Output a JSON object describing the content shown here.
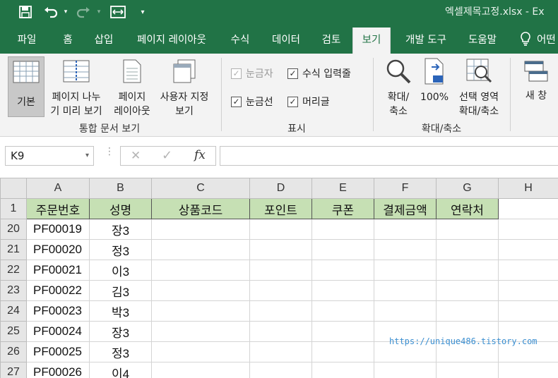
{
  "window": {
    "title": "엑셀제목고정.xlsx  -  Ex"
  },
  "quick_access": {
    "save_icon": "save-icon",
    "undo_icon": "undo-icon",
    "redo_icon": "redo-icon",
    "touch_icon": "touch-mode-icon",
    "customize_icon": "customize-qat-icon"
  },
  "colors": {
    "brand": "#217346",
    "header_fill": "#c6e0b4",
    "ribbon_bg": "#f3f3f3"
  },
  "tabs": [
    {
      "label": "파일"
    },
    {
      "label": "홈"
    },
    {
      "label": "삽입"
    },
    {
      "label": "페이지 레이아웃"
    },
    {
      "label": "수식"
    },
    {
      "label": "데이터"
    },
    {
      "label": "검토"
    },
    {
      "label": "보기",
      "active": true
    },
    {
      "label": "개발 도구"
    },
    {
      "label": "도움말"
    },
    {
      "label": "어떤"
    }
  ],
  "ribbon": {
    "views": {
      "normal": "기본",
      "page_break_1": "페이지 나누",
      "page_break_2": "기 미리 보기",
      "page_layout_1": "페이지",
      "page_layout_2": "레이아웃",
      "custom_1": "사용자 지정",
      "custom_2": "보기",
      "group_label": "통합 문서 보기"
    },
    "show": {
      "ruler": "눈금자",
      "formula_bar": "수식 입력줄",
      "gridlines": "눈금선",
      "headings": "머리글",
      "group_label": "표시"
    },
    "zoom": {
      "zoom_1": "확대/",
      "zoom_2": "축소",
      "hundred": "100%",
      "selection_1": "선택 영역",
      "selection_2": "확대/축소",
      "group_label": "확대/축소"
    },
    "window": {
      "new_window": "새 창"
    }
  },
  "formula_bar": {
    "name_box": "K9",
    "cancel": "✕",
    "enter": "✓",
    "fx": "fx",
    "value": ""
  },
  "sheet": {
    "columns": [
      "A",
      "B",
      "C",
      "D",
      "E",
      "F",
      "G",
      "H"
    ],
    "header_row_number": "1",
    "headers": [
      "주문번호",
      "성명",
      "상품코드",
      "포인트",
      "쿠폰",
      "결제금액",
      "연락처"
    ],
    "rows": [
      {
        "num": "20",
        "a": "PF00019",
        "b": "장3"
      },
      {
        "num": "21",
        "a": "PF00020",
        "b": "정3"
      },
      {
        "num": "22",
        "a": "PF00021",
        "b": "이3"
      },
      {
        "num": "23",
        "a": "PF00022",
        "b": "김3"
      },
      {
        "num": "24",
        "a": "PF00023",
        "b": "박3"
      },
      {
        "num": "25",
        "a": "PF00024",
        "b": "장3"
      },
      {
        "num": "26",
        "a": "PF00025",
        "b": "정3"
      },
      {
        "num": "27",
        "a": "PF00026",
        "b": "이4"
      }
    ]
  },
  "watermark": "https://unique486.tistory.com"
}
